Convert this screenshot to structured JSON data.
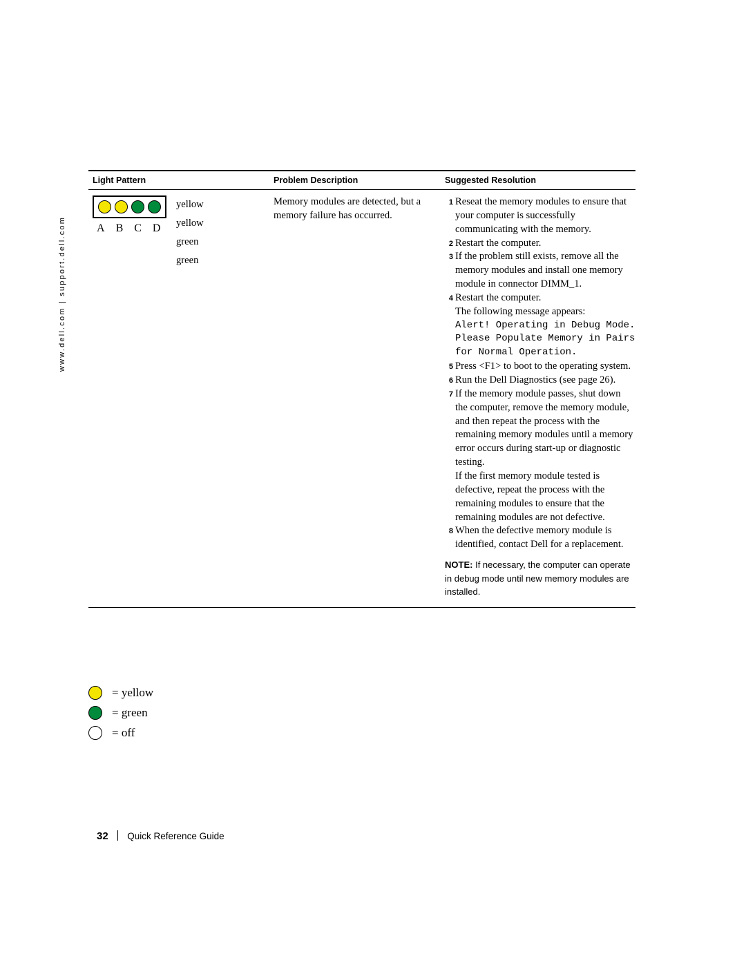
{
  "side_url": "www.dell.com | support.dell.com",
  "table": {
    "headers": {
      "light_pattern": "Light Pattern",
      "problem_description": "Problem Description",
      "suggested_resolution": "Suggested Resolution"
    },
    "light_pattern": {
      "leds": [
        "yellow",
        "yellow",
        "green",
        "green"
      ],
      "labels": [
        "A",
        "B",
        "C",
        "D"
      ],
      "color_words": [
        "yellow",
        "yellow",
        "green",
        "green"
      ]
    },
    "problem_description": "Memory modules are detected, but a memory failure has occurred.",
    "resolution_steps": [
      {
        "num": "1",
        "text": "Reseat the memory modules to ensure that your computer is successfully communicating with the memory."
      },
      {
        "num": "2",
        "text": "Restart the computer."
      },
      {
        "num": "3",
        "text": "If the problem still exists, remove all the memory modules and install one memory module in connector DIMM_1."
      },
      {
        "num": "4",
        "text": "Restart the computer."
      }
    ],
    "message_intro": "The following message appears:",
    "message_mono": "Alert! Operating in Debug Mode. Please Populate Memory in Pairs for Normal Operation.",
    "resolution_steps2": [
      {
        "num": "5",
        "text": "Press <F1> to boot to the operating system."
      },
      {
        "num": "6",
        "text": "Run the Dell Diagnostics (see page 26)."
      },
      {
        "num": "7",
        "text": "If the memory module passes, shut down the computer, remove the memory module, and then repeat the process with the remaining memory modules until a memory error occurs during start-up or diagnostic testing."
      }
    ],
    "paragraph": "If the first memory module tested is defective, repeat the process with the remaining modules to ensure that the remaining modules are not defective.",
    "resolution_steps3": [
      {
        "num": "8",
        "text": "When the defective memory module is identified, contact Dell for a replacement."
      }
    ],
    "note_label": "NOTE:",
    "note_text": "If necessary, the computer can operate in debug mode until new memory modules are installed."
  },
  "legend": [
    {
      "color": "yellow",
      "label": "= yellow"
    },
    {
      "color": "green",
      "label": "= green"
    },
    {
      "color": "off",
      "label": "= off"
    }
  ],
  "footer": {
    "page_number": "32",
    "title": "Quick Reference Guide"
  },
  "colors": {
    "yellow": "#f4e500",
    "green": "#008a3c",
    "off": "#ffffff"
  }
}
